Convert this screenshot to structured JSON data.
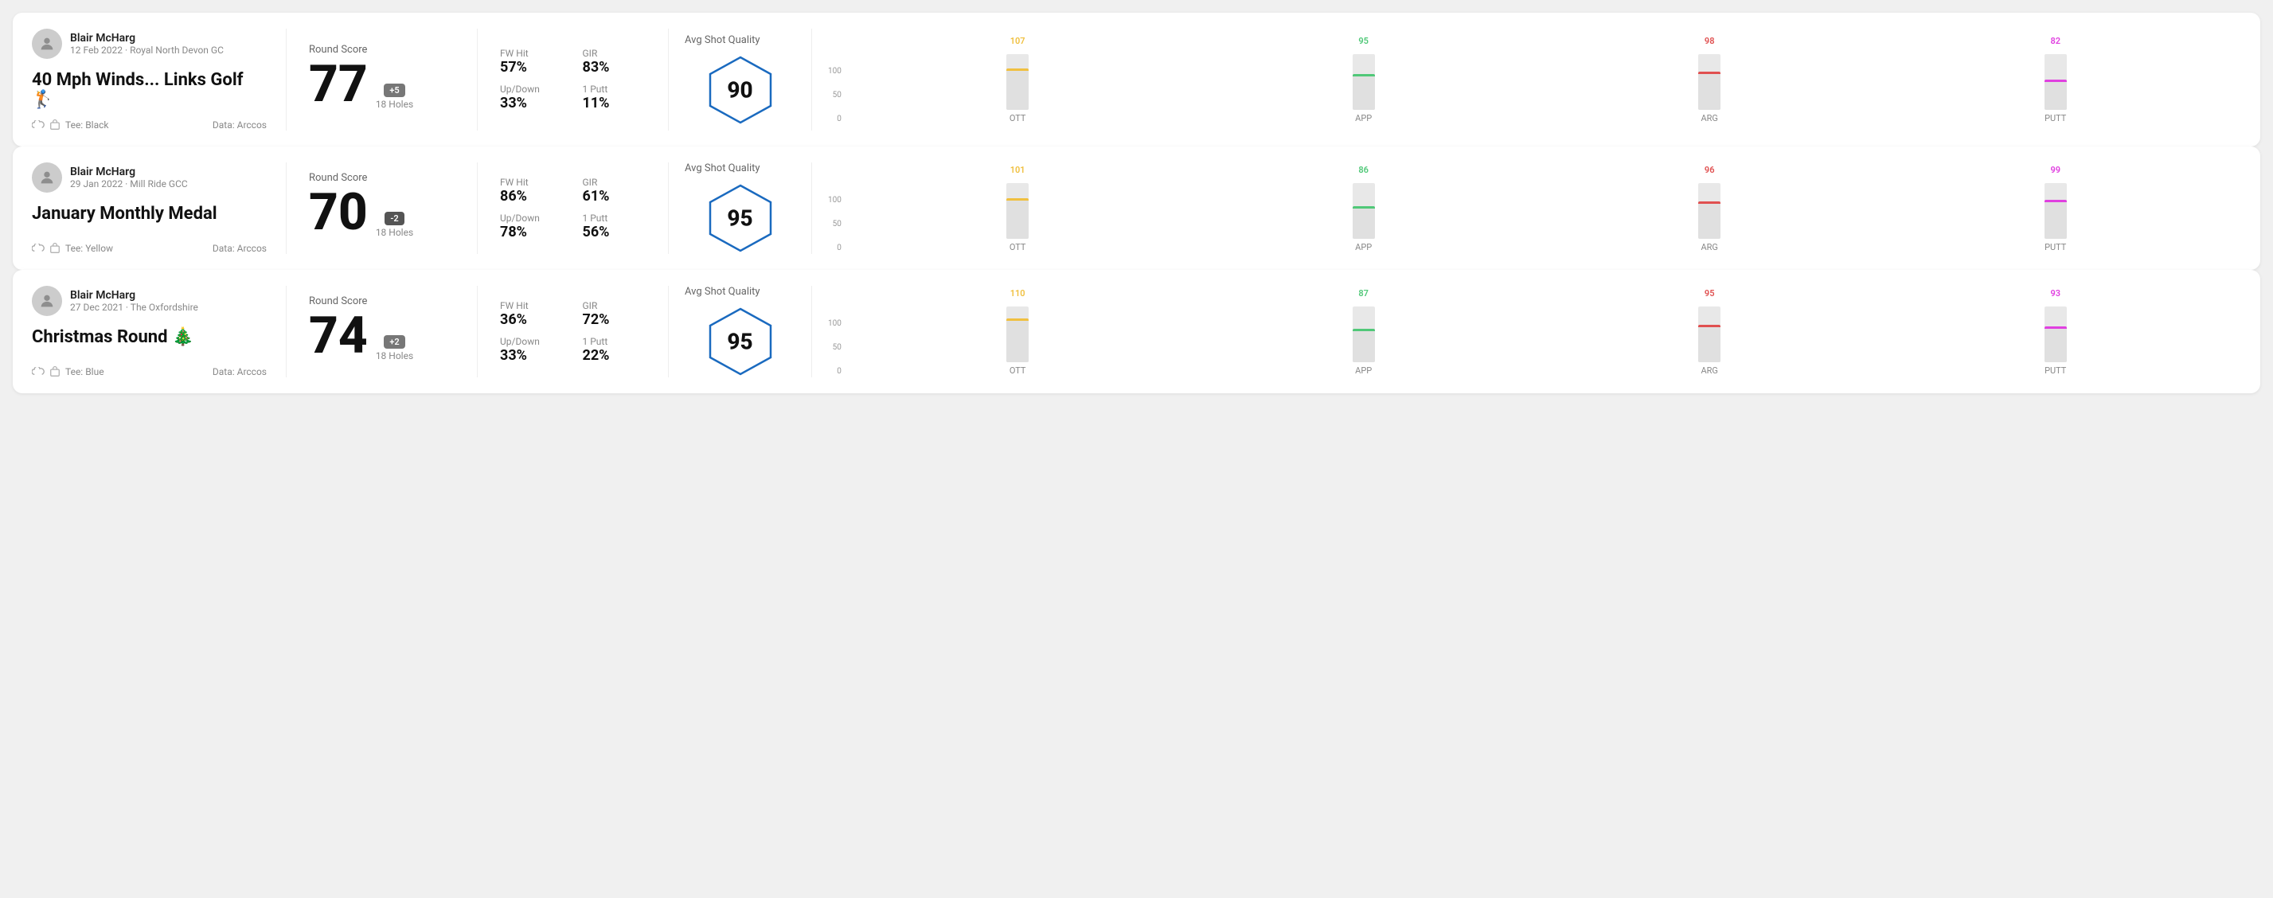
{
  "rounds": [
    {
      "id": "round1",
      "user": {
        "name": "Blair McHarg",
        "date_course": "12 Feb 2022 · Royal North Devon GC"
      },
      "title": "40 Mph Winds... Links Golf 🏌",
      "tee": "Tee: Black",
      "data_source": "Data: Arccos",
      "round_score_label": "Round Score",
      "score": "77",
      "score_diff": "+5",
      "score_diff_type": "plus",
      "holes": "18 Holes",
      "fw_hit_label": "FW Hit",
      "fw_hit": "57%",
      "gir_label": "GIR",
      "gir": "83%",
      "updown_label": "Up/Down",
      "updown": "33%",
      "oneputt_label": "1 Putt",
      "oneputt": "11%",
      "quality_label": "Avg Shot Quality",
      "quality_score": "90",
      "chart": {
        "cols": [
          {
            "label": "OTT",
            "value": 107,
            "color": "#f0c040",
            "bar_pct": 75
          },
          {
            "label": "APP",
            "value": 95,
            "color": "#50c878",
            "bar_pct": 65
          },
          {
            "label": "ARG",
            "value": 98,
            "color": "#e05050",
            "bar_pct": 68
          },
          {
            "label": "PUTT",
            "value": 82,
            "color": "#e040e0",
            "bar_pct": 55
          }
        ],
        "y_labels": [
          "100",
          "50",
          "0"
        ]
      }
    },
    {
      "id": "round2",
      "user": {
        "name": "Blair McHarg",
        "date_course": "29 Jan 2022 · Mill Ride GCC"
      },
      "title": "January Monthly Medal",
      "tee": "Tee: Yellow",
      "data_source": "Data: Arccos",
      "round_score_label": "Round Score",
      "score": "70",
      "score_diff": "-2",
      "score_diff_type": "minus",
      "holes": "18 Holes",
      "fw_hit_label": "FW Hit",
      "fw_hit": "86%",
      "gir_label": "GIR",
      "gir": "61%",
      "updown_label": "Up/Down",
      "updown": "78%",
      "oneputt_label": "1 Putt",
      "oneputt": "56%",
      "quality_label": "Avg Shot Quality",
      "quality_score": "95",
      "chart": {
        "cols": [
          {
            "label": "OTT",
            "value": 101,
            "color": "#f0c040",
            "bar_pct": 72
          },
          {
            "label": "APP",
            "value": 86,
            "color": "#50c878",
            "bar_pct": 58
          },
          {
            "label": "ARG",
            "value": 96,
            "color": "#e05050",
            "bar_pct": 67
          },
          {
            "label": "PUTT",
            "value": 99,
            "color": "#e040e0",
            "bar_pct": 70
          }
        ],
        "y_labels": [
          "100",
          "50",
          "0"
        ]
      }
    },
    {
      "id": "round3",
      "user": {
        "name": "Blair McHarg",
        "date_course": "27 Dec 2021 · The Oxfordshire"
      },
      "title": "Christmas Round 🎄",
      "tee": "Tee: Blue",
      "data_source": "Data: Arccos",
      "round_score_label": "Round Score",
      "score": "74",
      "score_diff": "+2",
      "score_diff_type": "plus",
      "holes": "18 Holes",
      "fw_hit_label": "FW Hit",
      "fw_hit": "36%",
      "gir_label": "GIR",
      "gir": "72%",
      "updown_label": "Up/Down",
      "updown": "33%",
      "oneputt_label": "1 Putt",
      "oneputt": "22%",
      "quality_label": "Avg Shot Quality",
      "quality_score": "95",
      "chart": {
        "cols": [
          {
            "label": "OTT",
            "value": 110,
            "color": "#f0c040",
            "bar_pct": 78
          },
          {
            "label": "APP",
            "value": 87,
            "color": "#50c878",
            "bar_pct": 59
          },
          {
            "label": "ARG",
            "value": 95,
            "color": "#e05050",
            "bar_pct": 66
          },
          {
            "label": "PUTT",
            "value": 93,
            "color": "#e040e0",
            "bar_pct": 64
          }
        ],
        "y_labels": [
          "100",
          "50",
          "0"
        ]
      }
    }
  ]
}
